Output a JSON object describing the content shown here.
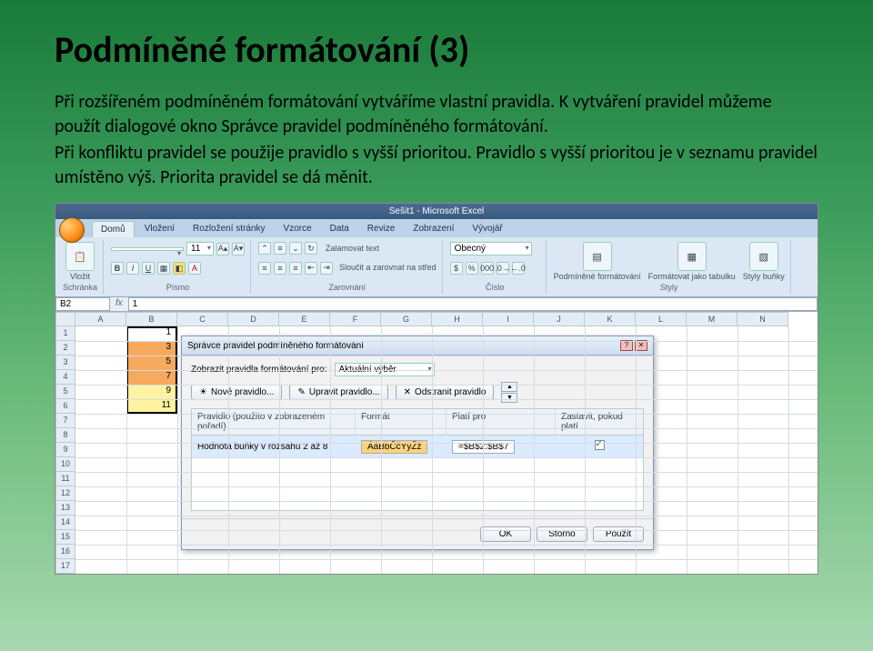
{
  "slide": {
    "title": "Podmíněné formátování (3)",
    "p1": "Při rozšířeném podmíněném formátování vytváříme vlastní pravidla. K vytváření pravidel můžeme použít dialogové okno Správce pravidel podmíněného formátování.",
    "p2": "Při konfliktu pravidel se použije pravidlo s vyšší prioritou. Pravidlo s vyšší prioritou je v seznamu pravidel umístěno výš. Priorita pravidel se dá měnit."
  },
  "excel": {
    "windowTitle": "Sešit1 - Microsoft Excel",
    "tabs": [
      "Domů",
      "Vložení",
      "Rozložení stránky",
      "Vzorce",
      "Data",
      "Revize",
      "Zobrazení",
      "Vývojář"
    ],
    "ribbon": {
      "paste": "Vložit",
      "clipboard": "Schránka",
      "fontName": "",
      "fontSize": "11",
      "fontGroup": "Písmo",
      "alignGroup": "Zarovnání",
      "wrap": "Zalamovat text",
      "merge": "Sloučit a zarovnat na střed",
      "numberFmt": "Obecný",
      "numberGroup": "Číslo",
      "condFmt": "Podmíněné formátování",
      "tableFmt": "Formátovat jako tabulku",
      "cellStyles": "Styly buňky",
      "stylesGroup": "Styly"
    },
    "nameBox": "B2",
    "fxLabel": "fx",
    "formulaValue": "1",
    "colHeaders": [
      "A",
      "B",
      "C",
      "D",
      "E",
      "F",
      "G",
      "H",
      "I",
      "J",
      "K",
      "L",
      "M",
      "N"
    ],
    "rowCount": 17,
    "bValues": [
      "1",
      "3",
      "5",
      "7",
      "9",
      "11"
    ]
  },
  "dialog": {
    "title": "Správce pravidel podmíněného formátování",
    "showLabel": "Zobrazit pravidla formátování pro:",
    "showValue": "Aktuální výběr",
    "newRule": "Nové pravidlo...",
    "editRule": "Upravit pravidlo...",
    "deleteRule": "Odstranit pravidlo",
    "colRule": "Pravidlo (použito v zobrazeném pořadí)",
    "colFormat": "Formát",
    "colApplies": "Platí pro",
    "colStop": "Zastavit, pokud platí",
    "ruleText": "Hodnota buňky v rozsahu 2 až 8",
    "previewText": "ÁáBbČčYyŽž",
    "appliesTo": "=$B$2:$B$7",
    "ok": "OK",
    "cancel": "Storno",
    "apply": "Použít"
  }
}
